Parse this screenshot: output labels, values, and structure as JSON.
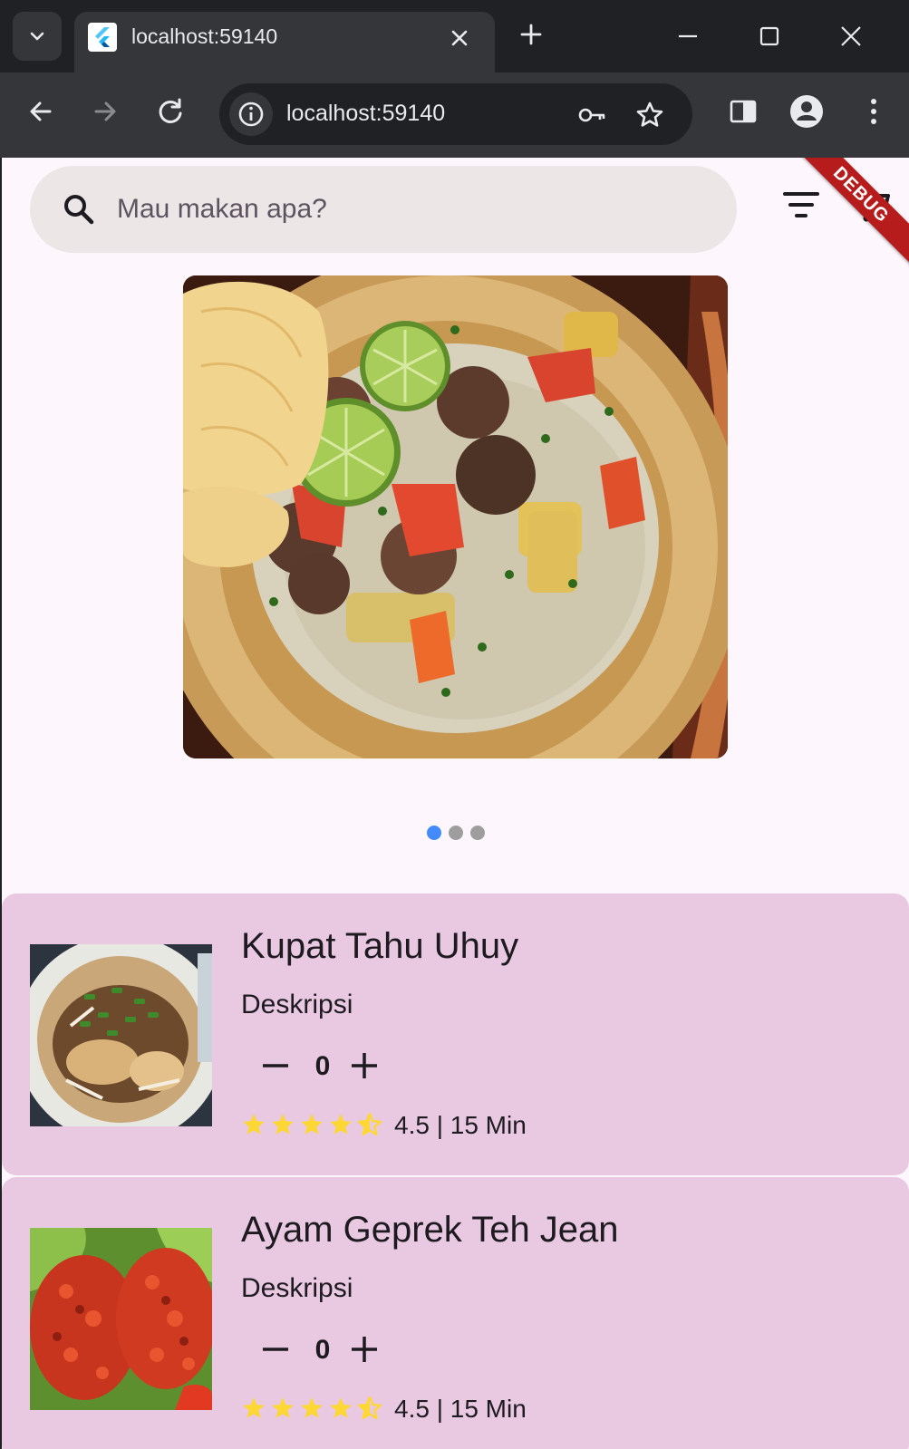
{
  "browser": {
    "tab_title": "localhost:59140",
    "url": "localhost:59140"
  },
  "search": {
    "placeholder": "Mau makan apa?"
  },
  "debug_banner": "DEBUG",
  "carousel": {
    "slide_count": 3,
    "active_index": 0,
    "active_dot_color": "#448aff",
    "dot_color": "#9e9e9e"
  },
  "colors": {
    "card_background": "#e9c8e2",
    "page_background": "#fdf7fd",
    "star_color": "#fdd835"
  },
  "foods": [
    {
      "name": "Kupat Tahu Uhuy",
      "description": "Deskripsi",
      "quantity": "0",
      "stars": 4.5,
      "rating_text": "4.5 | 15 Min"
    },
    {
      "name": "Ayam Geprek Teh Jean",
      "description": "Deskripsi",
      "quantity": "0",
      "stars": 4.5,
      "rating_text": "4.5 | 15 Min"
    }
  ]
}
